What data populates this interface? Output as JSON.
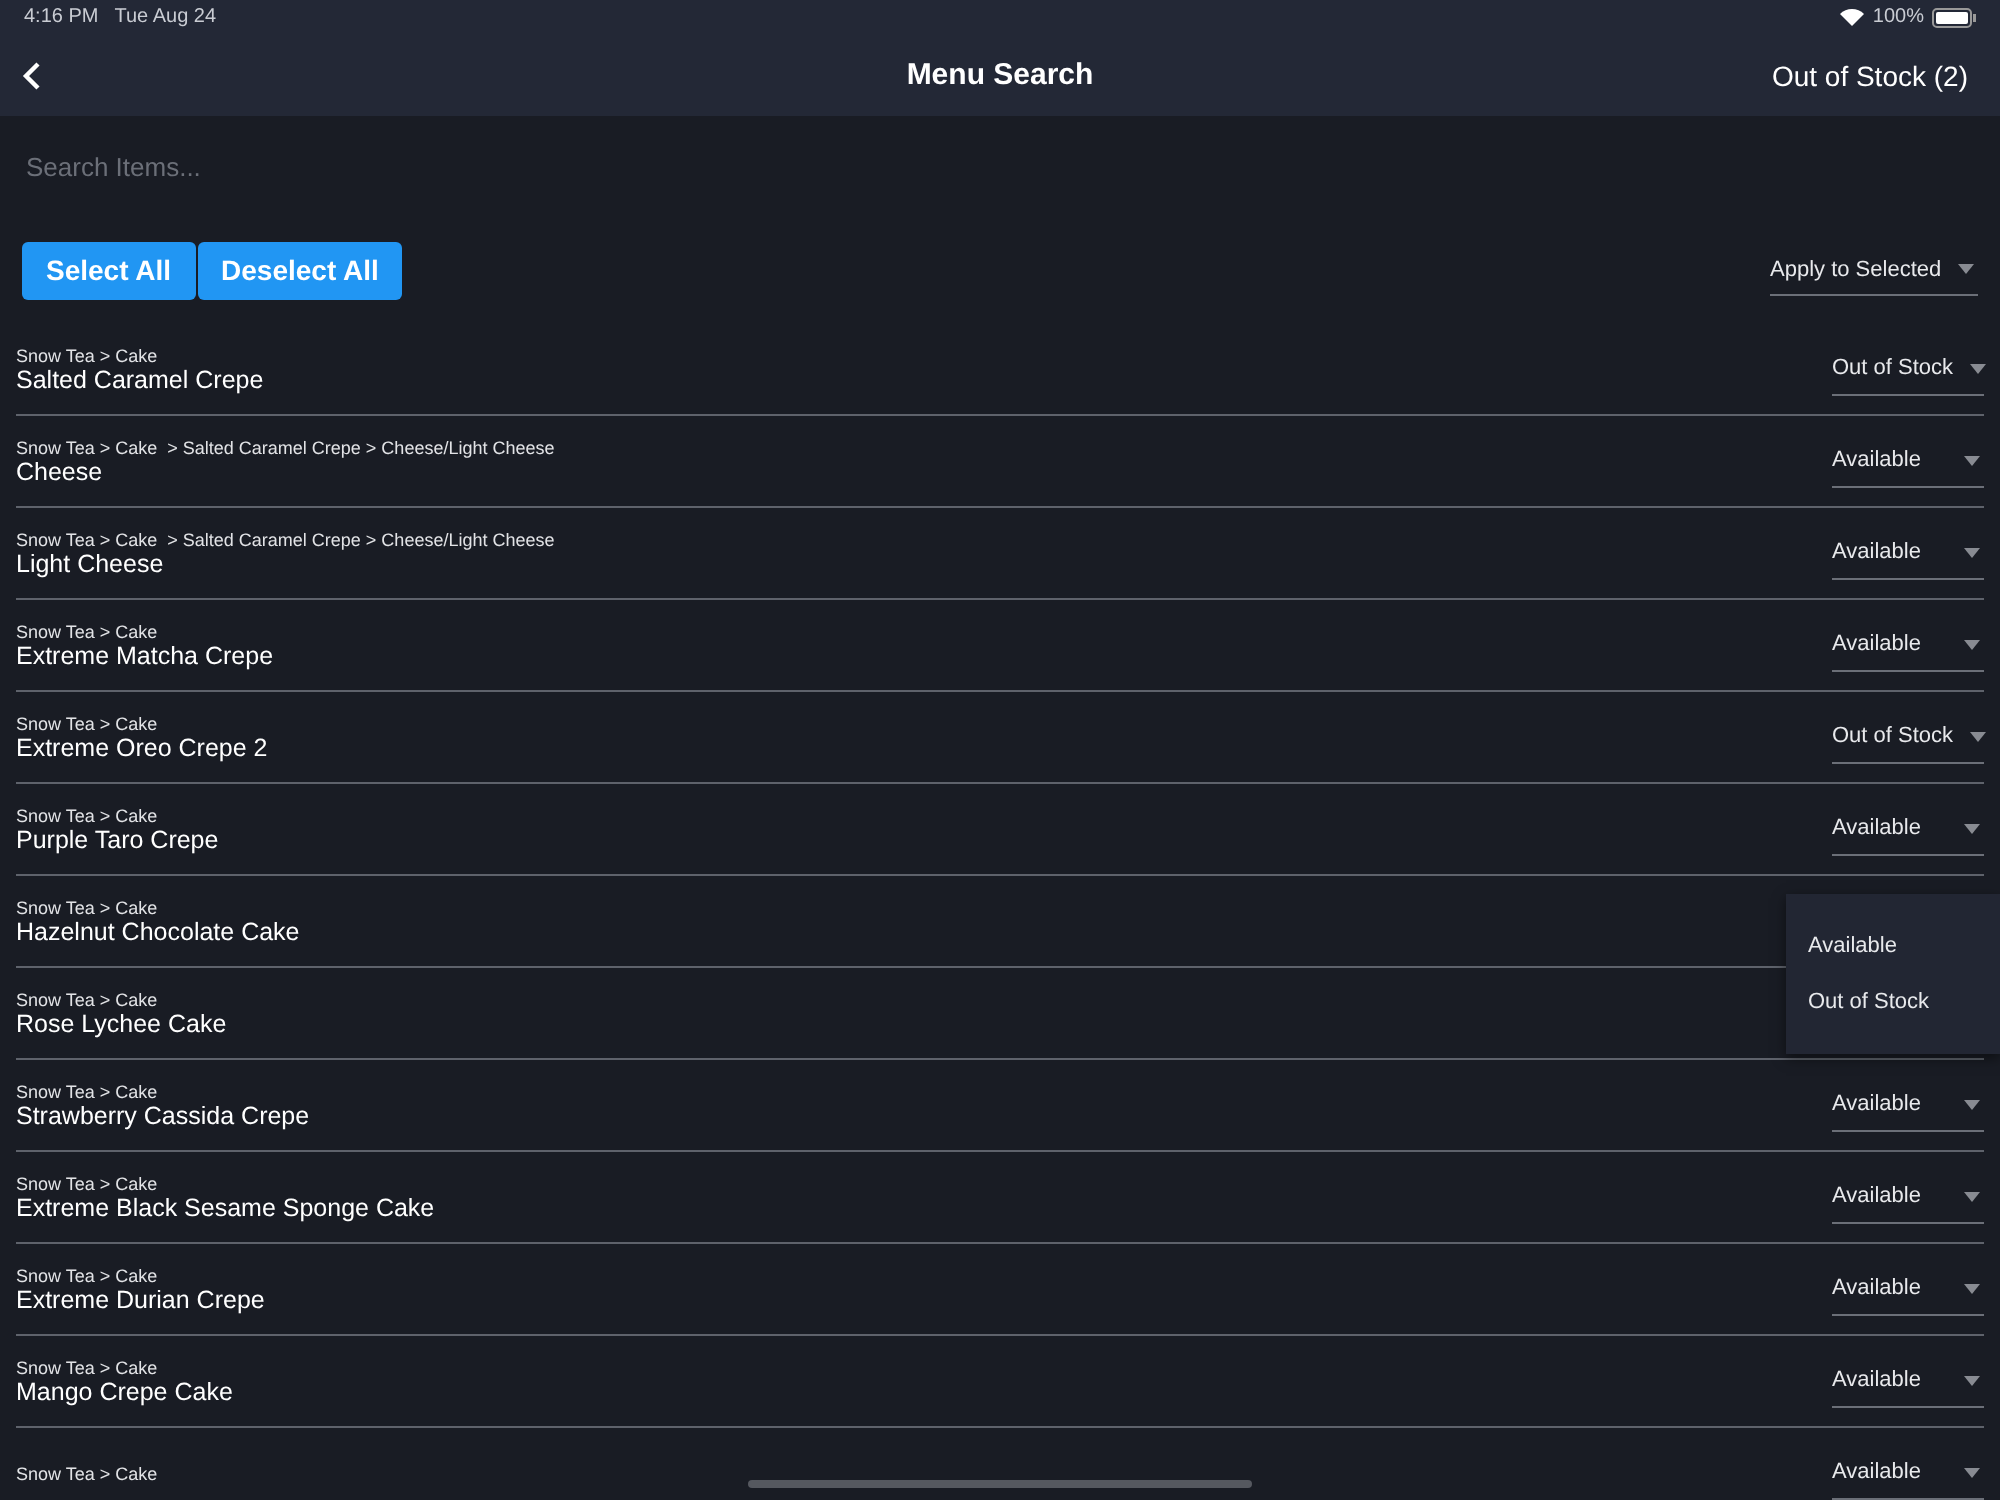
{
  "status_bar": {
    "time": "4:16 PM",
    "date": "Tue Aug 24",
    "battery": "100%"
  },
  "nav": {
    "title": "Menu Search",
    "action": "Out of Stock (2)"
  },
  "search": {
    "placeholder": "Search Items..."
  },
  "buttons": [
    "Select All",
    "Deselect All"
  ],
  "bulk_select": {
    "value": "Apply to Selected"
  },
  "items": [
    {
      "path": "Snow Tea > Cake",
      "name": "Salted Caramel Crepe",
      "status": "Out of Stock"
    },
    {
      "path": "Snow Tea > Cake  > Salted Caramel Crepe > Cheese/Light Cheese",
      "name": "Cheese",
      "status": "Available"
    },
    {
      "path": "Snow Tea > Cake  > Salted Caramel Crepe > Cheese/Light Cheese",
      "name": "Light Cheese",
      "status": "Available"
    },
    {
      "path": "Snow Tea > Cake",
      "name": "Extreme Matcha Crepe",
      "status": "Available"
    },
    {
      "path": "Snow Tea > Cake",
      "name": "Extreme Oreo Crepe 2",
      "status": "Out of Stock"
    },
    {
      "path": "Snow Tea > Cake",
      "name": "Purple Taro Crepe",
      "status": "Available"
    },
    {
      "path": "Snow Tea > Cake",
      "name": "Hazelnut Chocolate Cake"
    },
    {
      "path": "Snow Tea > Cake",
      "name": "Rose Lychee Cake"
    },
    {
      "path": "Snow Tea > Cake",
      "name": "Strawberry Cassida Crepe",
      "status": "Available"
    },
    {
      "path": "Snow Tea > Cake",
      "name": "Extreme Black Sesame Sponge Cake",
      "status": "Available"
    },
    {
      "path": "Snow Tea > Cake",
      "name": "Extreme Durian Crepe",
      "status": "Available"
    },
    {
      "path": "Snow Tea > Cake",
      "name": "Mango Crepe Cake",
      "status": "Available"
    },
    {
      "path": "Snow Tea > Cake",
      "status": "Available"
    }
  ],
  "dropdown_menu": [
    "Available",
    "Out of Stock"
  ]
}
